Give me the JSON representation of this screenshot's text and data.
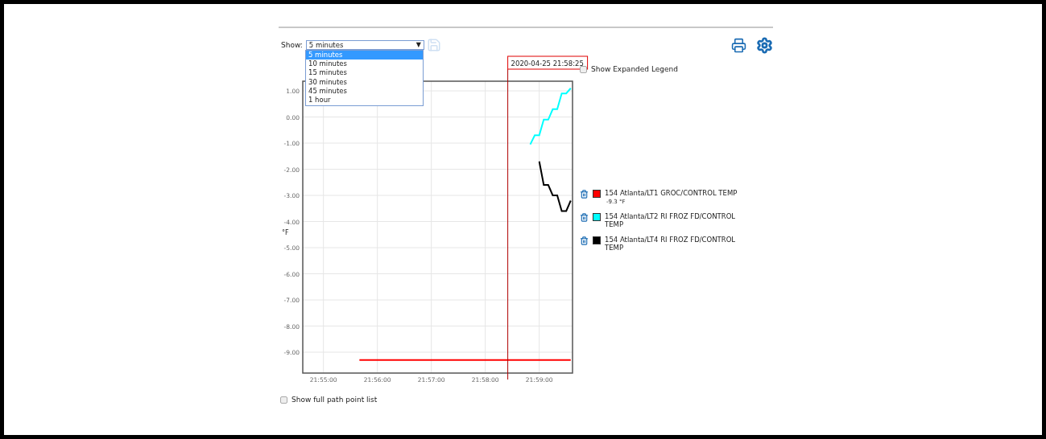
{
  "toolbar": {
    "show_label": "Show:",
    "range_select": {
      "value": "5 minutes",
      "caret": "▼",
      "expanded": true,
      "options": [
        {
          "label": "5 minutes",
          "selected": true
        },
        {
          "label": "10 minutes",
          "selected": false
        },
        {
          "label": "15 minutes",
          "selected": false
        },
        {
          "label": "30 minutes",
          "selected": false
        },
        {
          "label": "45 minutes",
          "selected": false
        },
        {
          "label": "1 hour",
          "selected": false
        }
      ]
    },
    "save": {
      "disabled": true
    }
  },
  "chart": {
    "chart_data": {
      "type": "line",
      "grid": true,
      "ylabel": "°F",
      "ylim": [
        -9.8,
        1.37
      ],
      "categories": [
        null,
        null,
        null,
        null,
        "21:55:00",
        null,
        null,
        null,
        null,
        null,
        null,
        null,
        null,
        null,
        null,
        null,
        "21:56:00",
        null,
        null,
        null,
        null,
        null,
        null,
        null,
        null,
        null,
        null,
        null,
        "21:57:00",
        null,
        null,
        null,
        null,
        null,
        null,
        null,
        null,
        null,
        null,
        null,
        "21:58:00",
        null,
        null,
        null,
        null,
        null,
        null,
        null,
        null,
        null,
        null,
        null,
        "21:59:00",
        null,
        null,
        null,
        null,
        null,
        null,
        null
      ],
      "yticks": [
        {
          "value": 1,
          "label": "1.00"
        },
        {
          "value": 0,
          "label": "0.00"
        },
        {
          "value": -1,
          "label": "-1.00"
        },
        {
          "value": -2,
          "label": "-2.00"
        },
        {
          "value": -3,
          "label": "-3.00"
        },
        {
          "value": -4,
          "label": "-4.00"
        },
        {
          "value": -5,
          "label": "-5.00"
        },
        {
          "value": -6,
          "label": "-6.00"
        },
        {
          "value": -7,
          "label": "-7.00"
        },
        {
          "value": -8,
          "label": "-8.00"
        },
        {
          "value": -9,
          "label": "-9.00"
        }
      ],
      "series": [
        {
          "name": "154 Atlanta/LT1 GROC/CONTROL TEMP",
          "color": "#ff0000",
          "values": [
            null,
            null,
            null,
            null,
            null,
            null,
            null,
            null,
            null,
            null,
            null,
            null,
            -9.3,
            -9.3,
            -9.3,
            -9.3,
            -9.3,
            -9.3,
            -9.3,
            -9.3,
            -9.3,
            -9.3,
            -9.3,
            -9.3,
            -9.3,
            -9.3,
            -9.3,
            -9.3,
            -9.3,
            -9.3,
            -9.3,
            -9.3,
            -9.3,
            -9.3,
            -9.3,
            -9.3,
            -9.3,
            -9.3,
            -9.3,
            -9.3,
            -9.3,
            -9.3,
            -9.3,
            -9.3,
            -9.3,
            -9.3,
            -9.3,
            -9.3,
            -9.3,
            -9.3,
            -9.3,
            -9.3,
            -9.3,
            -9.3,
            -9.3,
            -9.3,
            -9.3,
            -9.3,
            -9.3,
            -9.3
          ]
        },
        {
          "name": "154 Atlanta/LT2 RI FROZ FD/CONTROL TEMP",
          "color": "#00ffff",
          "values": [
            null,
            null,
            null,
            null,
            null,
            null,
            null,
            null,
            null,
            null,
            null,
            null,
            null,
            null,
            null,
            null,
            null,
            null,
            null,
            null,
            null,
            null,
            null,
            null,
            null,
            null,
            null,
            null,
            null,
            null,
            null,
            null,
            null,
            null,
            null,
            null,
            null,
            null,
            null,
            null,
            null,
            null,
            null,
            null,
            null,
            null,
            null,
            null,
            null,
            null,
            -1.05,
            -0.7,
            -0.7,
            -0.1,
            -0.1,
            0.3,
            0.3,
            0.9,
            0.9,
            1.1
          ]
        },
        {
          "name": "154 Atlanta/LT4 RI FROZ FD/CONTROL TEMP",
          "color": "#000000",
          "values": [
            null,
            null,
            null,
            null,
            null,
            null,
            null,
            null,
            null,
            null,
            null,
            null,
            null,
            null,
            null,
            null,
            null,
            null,
            null,
            null,
            null,
            null,
            null,
            null,
            null,
            null,
            null,
            null,
            null,
            null,
            null,
            null,
            null,
            null,
            null,
            null,
            null,
            null,
            null,
            null,
            null,
            null,
            null,
            null,
            null,
            null,
            null,
            null,
            null,
            null,
            null,
            null,
            -1.7,
            -2.6,
            -2.6,
            -3.0,
            -3.0,
            -3.6,
            -3.6,
            -3.2
          ]
        }
      ],
      "annotations": [
        "2020-04-25 21:58:25"
      ]
    }
  },
  "expanded_legend": {
    "label": "Show Expanded Legend",
    "checked": false
  },
  "legend_readings": [
    "-9.3 °F"
  ],
  "full_path": {
    "label": "Show full path point list",
    "checked": false
  }
}
